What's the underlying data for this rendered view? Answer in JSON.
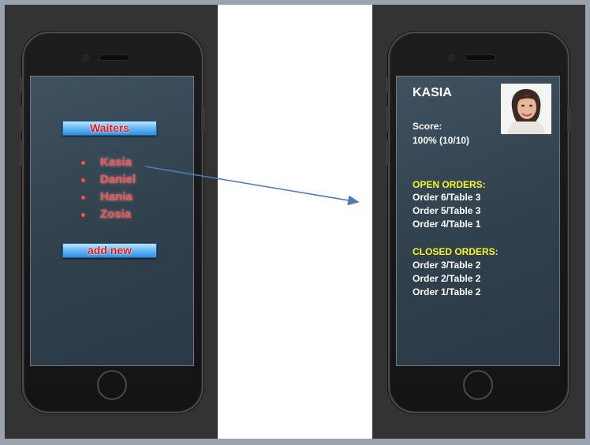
{
  "left_screen": {
    "waiters_button": "Waiters",
    "waiters": [
      "Kasia",
      "Daniel",
      "Hania",
      "Zosia"
    ],
    "add_new_button": "add new"
  },
  "right_screen": {
    "name": "KASIA",
    "score_label": "Score:",
    "score_value": "100% (10/10)",
    "open_orders_label": "OPEN ORDERS:",
    "open_orders": [
      "Order 6/Table 3",
      "Order 5/Table 3",
      "Order 4/Table 1"
    ],
    "closed_orders_label": "CLOSED ORDERS:",
    "closed_orders": [
      "Order 3/Table 2",
      "Order 2/Table 2",
      "Order 1/Table 2"
    ]
  },
  "colors": {
    "panel_bg": "#333333",
    "waiter_name": "#ff4d4d",
    "button_text": "#e0141c",
    "orders_heading": "#f7f72a",
    "arrow": "#4a7bbf"
  },
  "icons": {
    "avatar": "user-photo"
  }
}
